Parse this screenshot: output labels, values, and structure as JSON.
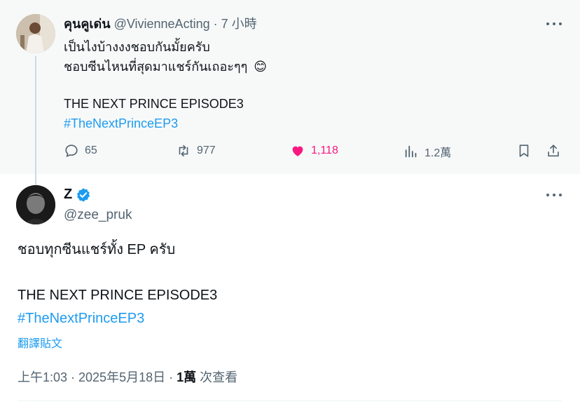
{
  "parent": {
    "name": "คุนคูเด่น",
    "handle": "@VivienneActing",
    "time": "· 7 小時",
    "line1": "เป็นไงบ้างงงชอบกันมั้ยครับ",
    "line2": "ชอบซีนไหนที่สุดมาแชร์กันเถอะๆๆ",
    "emoji": "😊",
    "line3": "THE NEXT PRINCE EPISODE3",
    "hashtag": "#TheNextPrinceEP3",
    "replies": "65",
    "retweets": "977",
    "likes": "1,118",
    "views": "1.2萬"
  },
  "main": {
    "name": "Z",
    "handle": "@zee_pruk",
    "line1": "ชอบทุกซีนแชร์ทั้ง EP ครับ",
    "line2": "THE NEXT PRINCE EPISODE3",
    "hashtag": "#TheNextPrinceEP3",
    "translate": "翻譯貼文",
    "timestamp": "上午1:03 · 2025年5月18日 · ",
    "views_count": "1萬",
    "views_label": " 次查看"
  },
  "colors": {
    "accent": "#1d9bf0",
    "like": "#f91880",
    "muted": "#536471"
  },
  "icons": [
    "reply-icon",
    "retweet-icon",
    "heart-icon",
    "views-icon",
    "bookmark-icon",
    "share-icon",
    "more-icon",
    "verified-icon"
  ]
}
